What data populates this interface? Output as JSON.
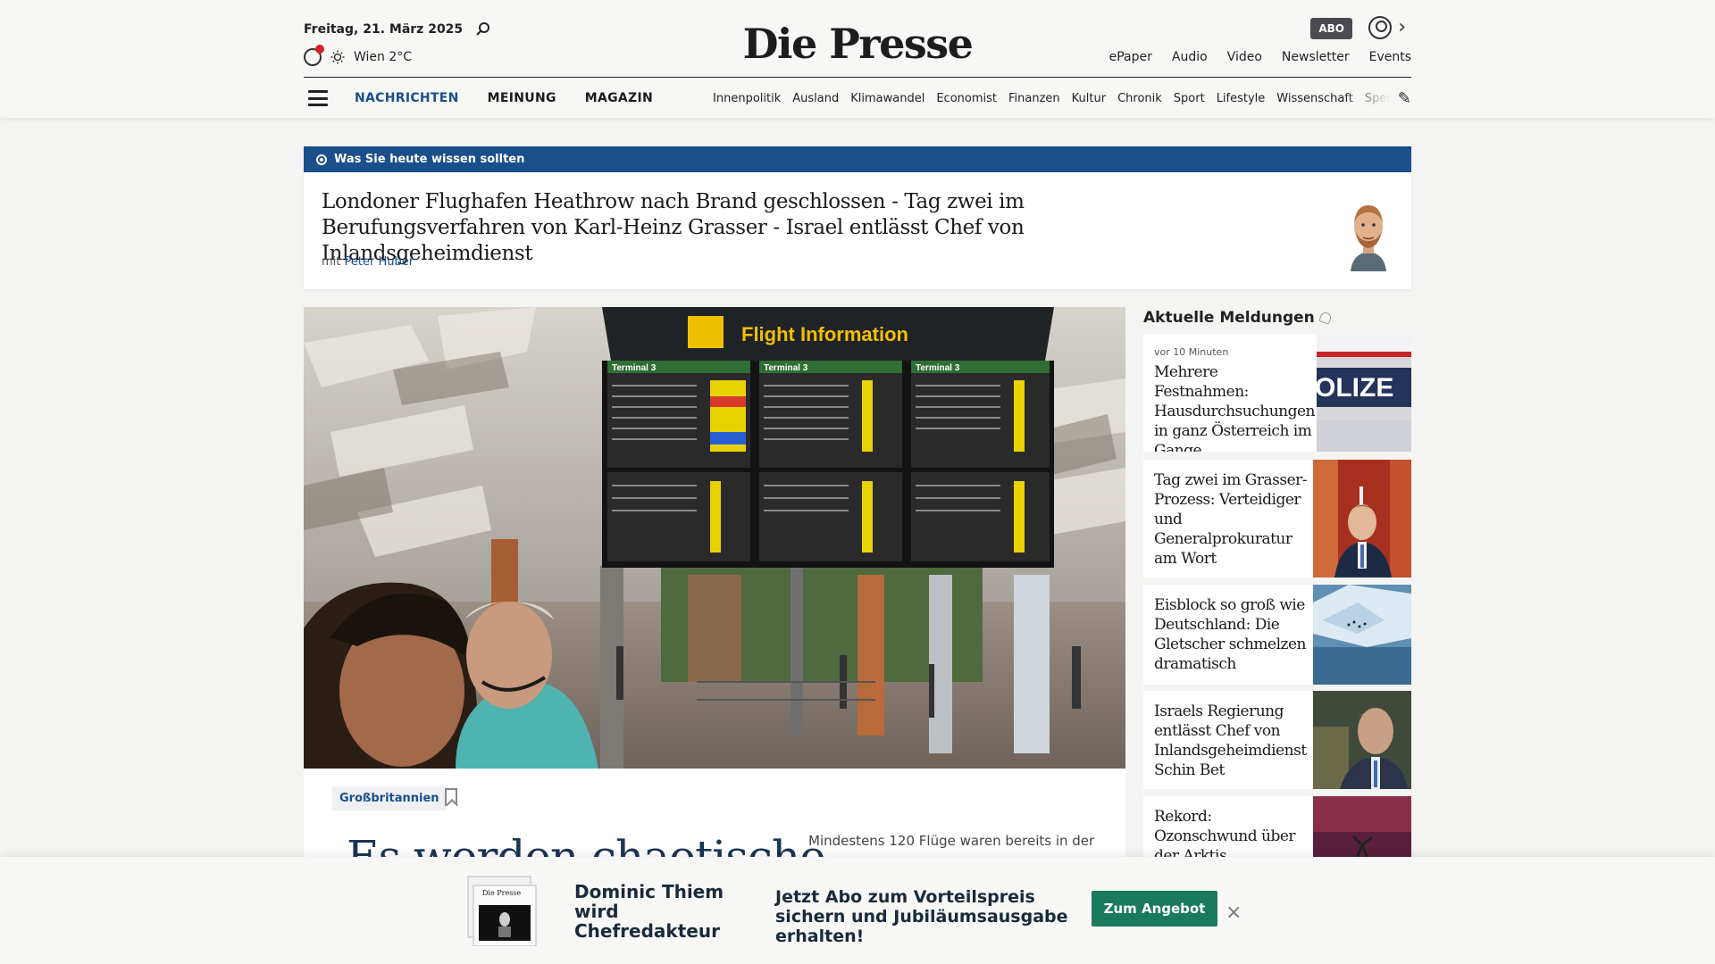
{
  "header": {
    "date": "Freitag, 21. März 2025",
    "weather": "Wien 2°C",
    "logo": "Die Presse",
    "abo": "ABO",
    "top_links": [
      "ePaper",
      "Audio",
      "Video",
      "Newsletter",
      "Events"
    ],
    "main_nav": [
      "NACHRICHTEN",
      "MEINUNG",
      "MAGAZIN"
    ],
    "sub_nav": [
      "Innenpolitik",
      "Ausland",
      "Klimawandel",
      "Economist",
      "Finanzen",
      "Kultur",
      "Chronik",
      "Sport",
      "Lifestyle",
      "Wissenschaft",
      "Spectrum"
    ]
  },
  "briefing": {
    "label": "Was Sie heute wissen sollten",
    "headline": "Londoner Flughafen Heathrow nach Brand geschlossen - Tag zwei im Berufungsverfahren von Karl-Heinz Grasser - Israel entlässt Chef von Inlandsgeheimdienst",
    "author_prefix": "mit",
    "author": "Peter Huber"
  },
  "hero": {
    "sign_text": "Flight Information",
    "terminal_label": "Terminal 3",
    "tag": "Großbritannien",
    "headline": "Es werden chaotische",
    "teaser": "Mindestens 120 Flüge waren bereits in der"
  },
  "sidebar": {
    "title": "Aktuelle Meldungen",
    "items": [
      {
        "time": "vor 10 Minuten",
        "title": "Mehrere Festnahmen: Hausdurchsuchungen in ganz Österreich im Gange",
        "image_text": "OLIZE"
      },
      {
        "title": "Tag zwei im Grasser-Prozess: Verteidiger und Generalprokuratur am Wort"
      },
      {
        "title": "Eisblock so groß wie Deutschland: Die Gletscher schmelzen dramatisch"
      },
      {
        "title": "Israels Regierung entlässt Chef von Inlandsgeheimdienst Schin Bet"
      },
      {
        "title": "Rekord: Ozonschwund über der Arktis"
      }
    ]
  },
  "ad": {
    "name": "Dominic Thiem wird Chefredakteur",
    "offer": "Jetzt Abo zum Vorteilspreis sichern und Jubiläumsausgabe erhalten!",
    "button": "Zum Angebot",
    "close": "×",
    "paper_logo": "Die Presse"
  },
  "colors": {
    "accent": "#1b4f8c",
    "cta": "#1a7a5e"
  }
}
